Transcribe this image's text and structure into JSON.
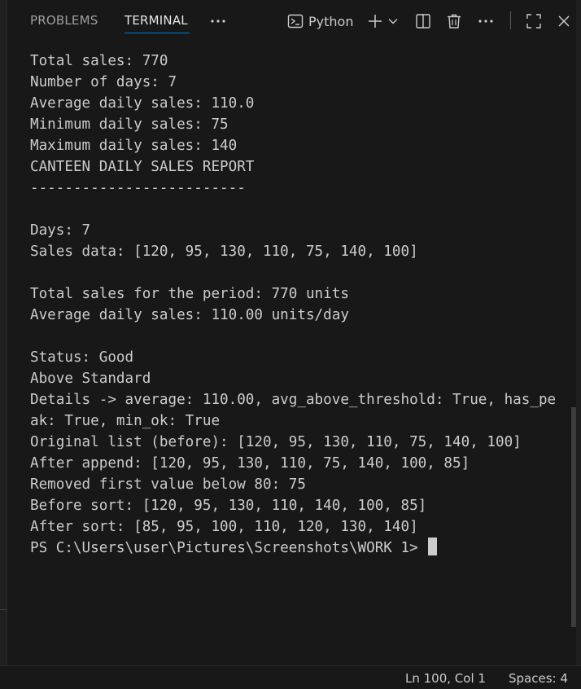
{
  "panel": {
    "tabs": [
      {
        "label": "PROBLEMS",
        "active": false
      },
      {
        "label": "TERMINAL",
        "active": true
      }
    ],
    "more_tabs_icon": "ellipsis-icon",
    "toolbar": {
      "profile_label": "Python",
      "profile_icon": "terminal-icon",
      "new_terminal_icon": "plus-icon",
      "dropdown_icon": "chevron-down-icon",
      "split_icon": "split-icon",
      "kill_icon": "trash-icon",
      "more_icon": "ellipsis-icon",
      "maximize_icon": "maximize-icon",
      "close_icon": "close-icon"
    }
  },
  "terminal": {
    "lines": [
      "Total sales: 770",
      "Number of days: 7",
      "Average daily sales: 110.0",
      "Minimum daily sales: 75",
      "Maximum daily sales: 140",
      "CANTEEN DAILY SALES REPORT",
      "-------------------------",
      "",
      "Days: 7",
      "Sales data: [120, 95, 130, 110, 75, 140, 100]",
      "",
      "Total sales for the period: 770 units",
      "Average daily sales: 110.00 units/day",
      "",
      "Status: Good",
      "Above Standard",
      "Details -> average: 110.00, avg_above_threshold: True, has_pe",
      "ak: True, min_ok: True",
      "Original list (before): [120, 95, 130, 110, 75, 140, 100]",
      "After append: [120, 95, 130, 110, 75, 140, 100, 85]",
      "Removed first value below 80: 75",
      "Before sort: [120, 95, 130, 110, 140, 100, 85]",
      "After sort: [85, 95, 100, 110, 120, 130, 140]"
    ],
    "prompt": "PS C:\\Users\\user\\Pictures\\Screenshots\\WORK 1> "
  },
  "statusbar": {
    "position": "Ln 100, Col 1",
    "spaces": "Spaces: 4"
  },
  "colors": {
    "background": "#181818",
    "text": "#cccccc",
    "accent": "#0078d4"
  }
}
